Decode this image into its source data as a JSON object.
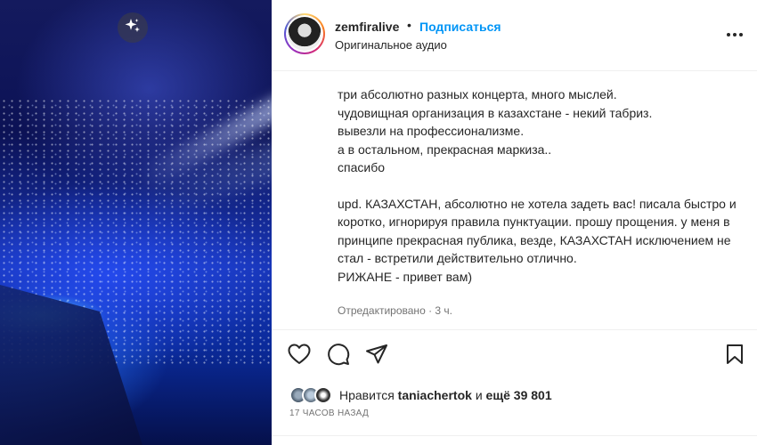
{
  "media": {
    "sparkle_icon": "sparkle-icon"
  },
  "header": {
    "username": "zemfiralive",
    "separator": "•",
    "follow_label": "Подписаться",
    "audio_label": "Оригинальное аудио",
    "more_icon": "more-horizontal-icon"
  },
  "caption": {
    "paragraph1": "три абсолютно разных концерта, много мыслей.\nчудовищная организация в казахстане - некий табриз.\nвывезли на профессионализме.\nа в остальном, прекрасная маркиза..\nспасибо",
    "paragraph2": "upd. КАЗАХСТАН, абсолютно не хотела задеть вас! писала быстро и коротко, игнорируя правила пунктуации. прошу прощения. у меня в принципе прекрасная публика, везде, КАЗАХСТАН исключением не стал - встретили действительно отлично.\nРИЖАНЕ - привет вам)",
    "edited": "Отредактировано · 3 ч."
  },
  "actions": {
    "like_icon": "heart-icon",
    "comment_icon": "comment-icon",
    "share_icon": "share-icon",
    "save_icon": "bookmark-icon"
  },
  "likes": {
    "prefix": "Нравится",
    "user": "taniachertok",
    "middle": "и",
    "count": "ещё 39 801"
  },
  "timestamp": "17 ЧАСОВ НАЗАД",
  "colors": {
    "accent": "#0095f6",
    "text": "#262626",
    "muted": "#737373"
  }
}
